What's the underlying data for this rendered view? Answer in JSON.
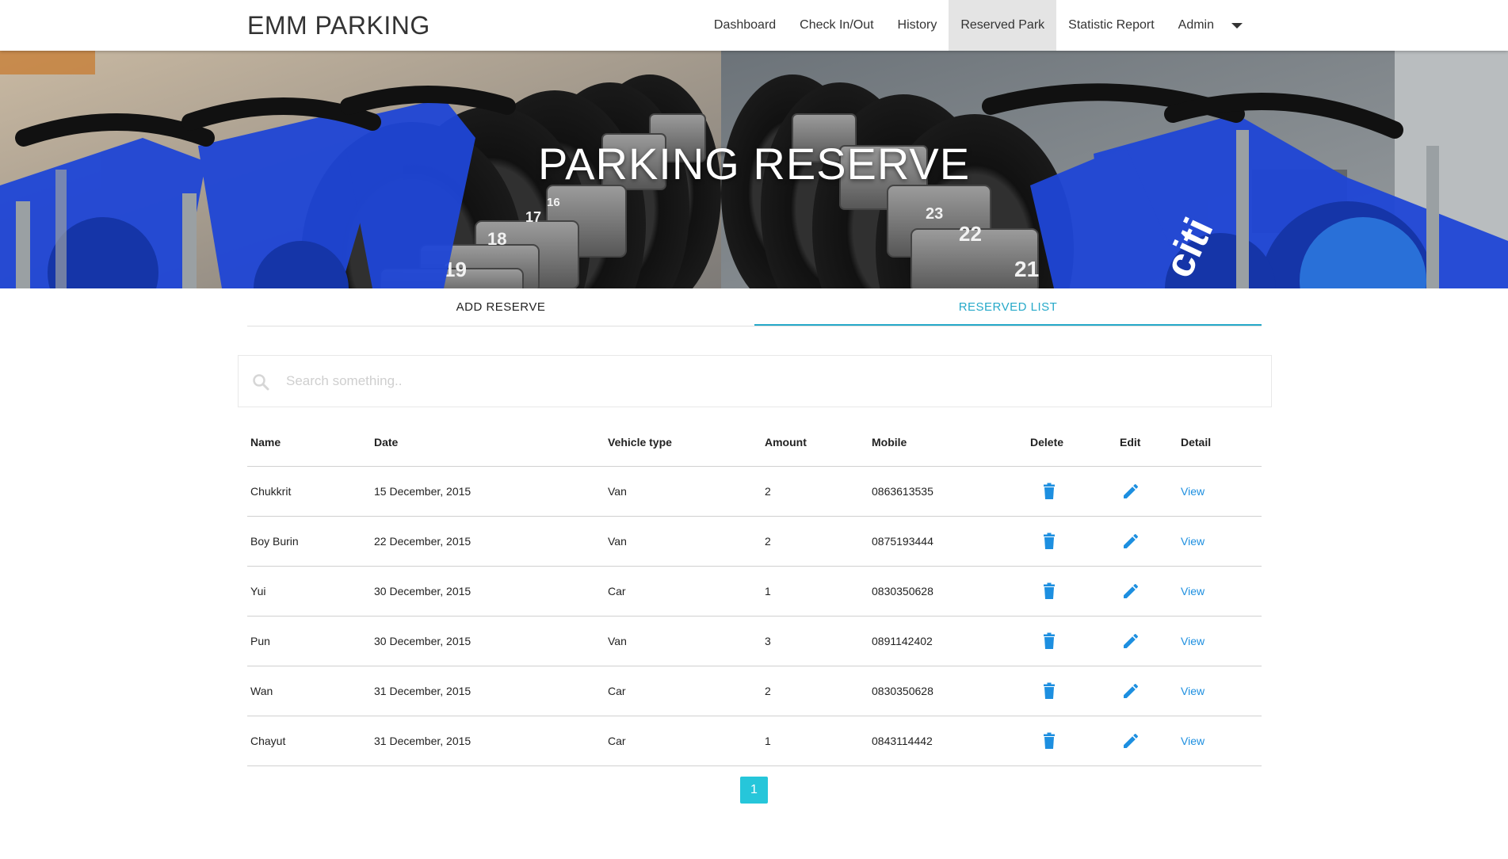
{
  "brand": "EMM PARKING",
  "nav": {
    "items": [
      "Dashboard",
      "Check In/Out",
      "History",
      "Reserved Park",
      "Statistic Report"
    ],
    "active": "Reserved Park",
    "admin": "Admin"
  },
  "hero": {
    "title": "PARKING RESERVE",
    "bike_numbers": [
      "19",
      "18",
      "17",
      "16",
      "23",
      "22",
      "21"
    ],
    "bike_logo": "citi"
  },
  "tabs": {
    "add": "ADD RESERVE",
    "list": "RESERVED LIST",
    "active": "list"
  },
  "search": {
    "placeholder": "Search something.."
  },
  "table": {
    "headers": {
      "name": "Name",
      "date": "Date",
      "vehicle": "Vehicle type",
      "amount": "Amount",
      "mobile": "Mobile",
      "delete": "Delete",
      "edit": "Edit",
      "detail": "Detail"
    },
    "view_label": "View",
    "rows": [
      {
        "name": "Chukkrit",
        "date": "15 December, 2015",
        "vehicle": "Van",
        "amount": "2",
        "mobile": "0863613535"
      },
      {
        "name": "Boy Burin",
        "date": "22 December, 2015",
        "vehicle": "Van",
        "amount": "2",
        "mobile": "0875193444"
      },
      {
        "name": "Yui",
        "date": "30 December, 2015",
        "vehicle": "Car",
        "amount": "1",
        "mobile": "0830350628"
      },
      {
        "name": "Pun",
        "date": "30 December, 2015",
        "vehicle": "Van",
        "amount": "3",
        "mobile": "0891142402"
      },
      {
        "name": "Wan",
        "date": "31 December, 2015",
        "vehicle": "Car",
        "amount": "2",
        "mobile": "0830350628"
      },
      {
        "name": "Chayut",
        "date": "31 December, 2015",
        "vehicle": "Car",
        "amount": "1",
        "mobile": "0843114442"
      }
    ]
  },
  "pagination": {
    "current": "1"
  },
  "colors": {
    "accent": "#26a9c9",
    "icon": "#1d8fe0",
    "pager": "#26c6da"
  }
}
